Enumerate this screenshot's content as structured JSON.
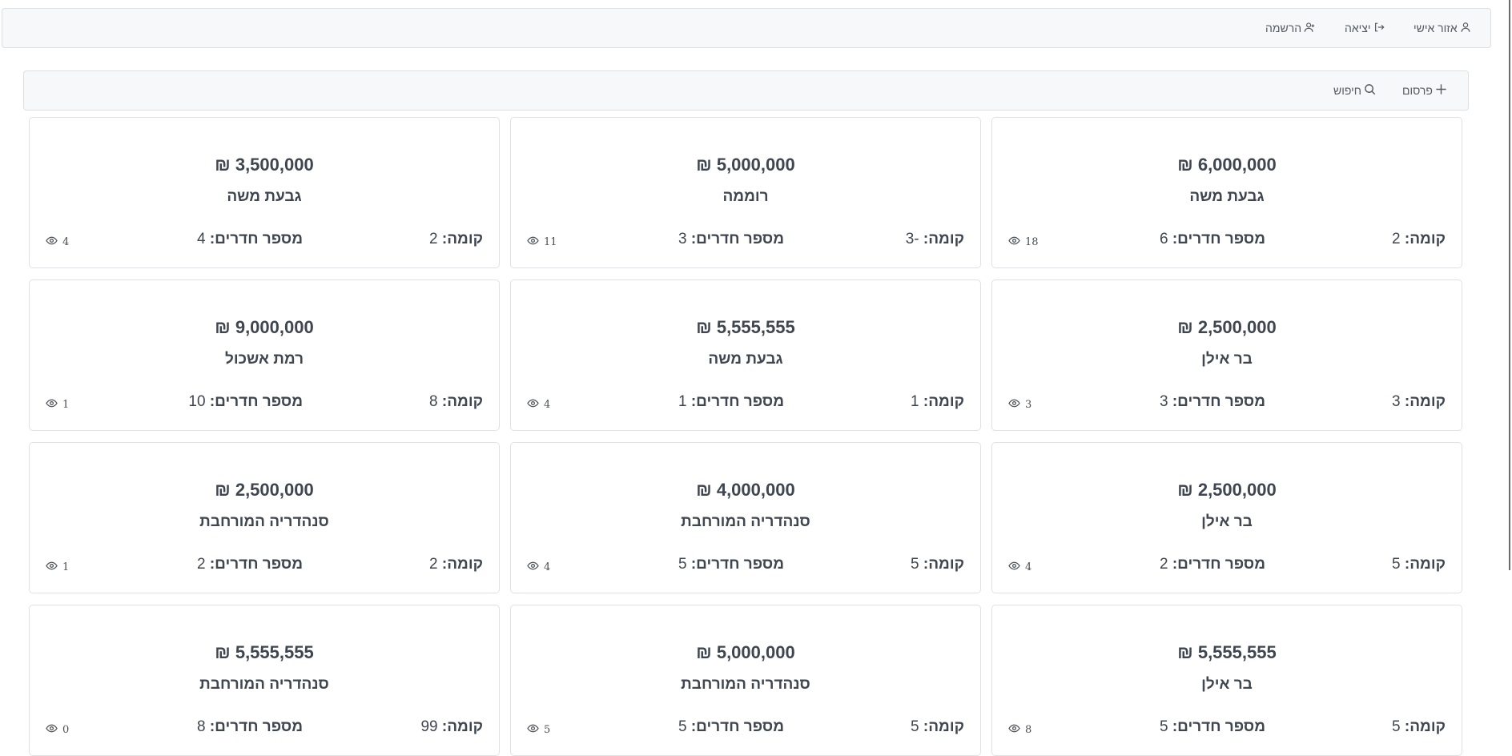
{
  "nav": {
    "profile_label": "אזור אישי",
    "logout_label": "יציאה",
    "register_label": "הרשמה"
  },
  "toolbar": {
    "publish_label": "פרסום",
    "search_label": "חיפוש"
  },
  "labels": {
    "floor": "קומה:",
    "rooms": "מספר חדרים:"
  },
  "listings": [
    {
      "price": "₪ 6,000,000",
      "area": "גבעת משה",
      "floor": "2",
      "rooms": "6",
      "views": "18"
    },
    {
      "price": "₪ 5,000,000",
      "area": "רוממה",
      "floor": "-3",
      "rooms": "3",
      "views": "11"
    },
    {
      "price": "₪ 3,500,000",
      "area": "גבעת משה",
      "floor": "2",
      "rooms": "4",
      "views": "4"
    },
    {
      "price": "₪ 2,500,000",
      "area": "בר אילן",
      "floor": "3",
      "rooms": "3",
      "views": "3"
    },
    {
      "price": "₪ 5,555,555",
      "area": "גבעת משה",
      "floor": "1",
      "rooms": "1",
      "views": "4"
    },
    {
      "price": "₪ 9,000,000",
      "area": "רמת אשכול",
      "floor": "8",
      "rooms": "10",
      "views": "1"
    },
    {
      "price": "₪ 2,500,000",
      "area": "בר אילן",
      "floor": "5",
      "rooms": "2",
      "views": "4"
    },
    {
      "price": "₪ 4,000,000",
      "area": "סנהדריה המורחבת",
      "floor": "5",
      "rooms": "5",
      "views": "4"
    },
    {
      "price": "₪ 2,500,000",
      "area": "סנהדריה המורחבת",
      "floor": "2",
      "rooms": "2",
      "views": "1"
    },
    {
      "price": "₪ 5,555,555",
      "area": "בר אילן",
      "floor": "5",
      "rooms": "5",
      "views": "8"
    },
    {
      "price": "₪ 5,000,000",
      "area": "סנהדריה המורחבת",
      "floor": "5",
      "rooms": "5",
      "views": "5"
    },
    {
      "price": "₪ 5,555,555",
      "area": "סנהדריה המורחבת",
      "floor": "99",
      "rooms": "8",
      "views": "0"
    }
  ]
}
